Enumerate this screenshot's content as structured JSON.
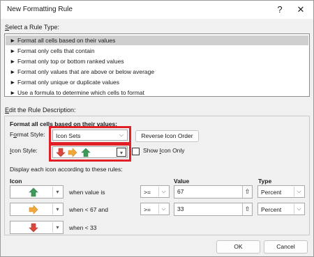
{
  "window": {
    "title": "New Formatting Rule",
    "help_glyph": "?",
    "close_glyph": "✕"
  },
  "rule_type": {
    "label": "Select a Rule Type:",
    "label_key": "S",
    "label_rest": "elect a Rule Type:",
    "arrow": "►",
    "items": [
      {
        "label": "Format all cells based on their values",
        "selected": true
      },
      {
        "label": "Format only cells that contain",
        "selected": false
      },
      {
        "label": "Format only top or bottom ranked values",
        "selected": false
      },
      {
        "label": "Format only values that are above or below average",
        "selected": false
      },
      {
        "label": "Format only unique or duplicate values",
        "selected": false
      },
      {
        "label": "Use a formula to determine which cells to format",
        "selected": false
      }
    ]
  },
  "description": {
    "label_key": "E",
    "label_rest": "dit the Rule Description:",
    "heading": "Format all cells based on their values:",
    "format_style_label_pre": "F",
    "format_style_label_key": "o",
    "format_style_label_post": "rmat Style:",
    "format_style_value": "Icon Sets",
    "reverse_icon_order": "Reverse Icon Order",
    "reverse_key": "d",
    "icon_style_label_key": "I",
    "icon_style_label_rest": "con Style:",
    "show_icon_only": "Show Icon Only",
    "show_icon_only_pre": "Show ",
    "show_icon_only_key": "I",
    "show_icon_only_post": "con Only",
    "display_text": "Display each icon according to these rules:",
    "col_icon": "Icon",
    "col_icon_key": "n",
    "col_value": "Value",
    "col_value_key": "V",
    "col_type": "Type",
    "col_type_key": "T"
  },
  "rules": [
    {
      "icon": "green-up-arrow-icon",
      "condition": "when value is",
      "operator": ">=",
      "value": "67",
      "type": "Percent"
    },
    {
      "icon": "yellow-right-arrow-icon",
      "condition": "when < 67 and",
      "operator": ">=",
      "value": "33",
      "type": "Percent"
    },
    {
      "icon": "red-down-arrow-icon",
      "condition": "when < 33"
    }
  ],
  "footer": {
    "ok": "OK",
    "cancel": "Cancel"
  },
  "colors": {
    "highlight_red": "#e01f26",
    "arrow_green": "#3e9a5a",
    "arrow_yellow": "#f2a93b",
    "arrow_red": "#d9483b"
  }
}
